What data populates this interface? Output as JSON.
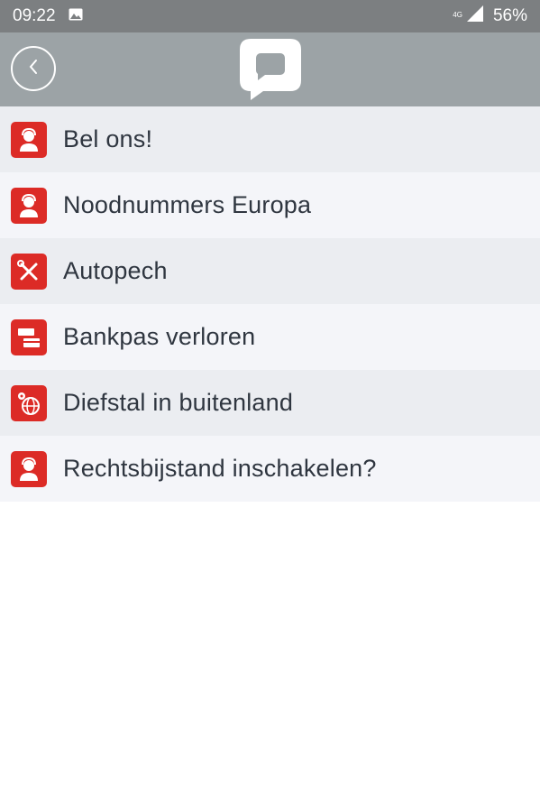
{
  "status_bar": {
    "time": "09:22",
    "network": "4G",
    "battery": "56%",
    "icons": [
      "image-notification-icon",
      "signal-icon"
    ]
  },
  "header": {
    "back_icon": "back-icon",
    "logo_icon": "speech-bubble-logo"
  },
  "menu": {
    "items": [
      {
        "label": "Bel ons!",
        "icon": "call-center-agent-icon"
      },
      {
        "label": "Noodnummers Europa",
        "icon": "call-center-agent-icon"
      },
      {
        "label": "Autopech",
        "icon": "tools-icon"
      },
      {
        "label": "Bankpas verloren",
        "icon": "bank-card-icon"
      },
      {
        "label": "Diefstal in buitenland",
        "icon": "globe-gear-icon"
      },
      {
        "label": "Rechtsbijstand inschakelen?",
        "icon": "call-center-agent-icon"
      }
    ]
  },
  "colors": {
    "status_bar": "#7c7f81",
    "app_bar": "#9ca3a6",
    "icon_red": "#dc2b26",
    "row_dark": "#ebedf1",
    "row_light": "#f4f5f9",
    "text": "#2f3640"
  }
}
